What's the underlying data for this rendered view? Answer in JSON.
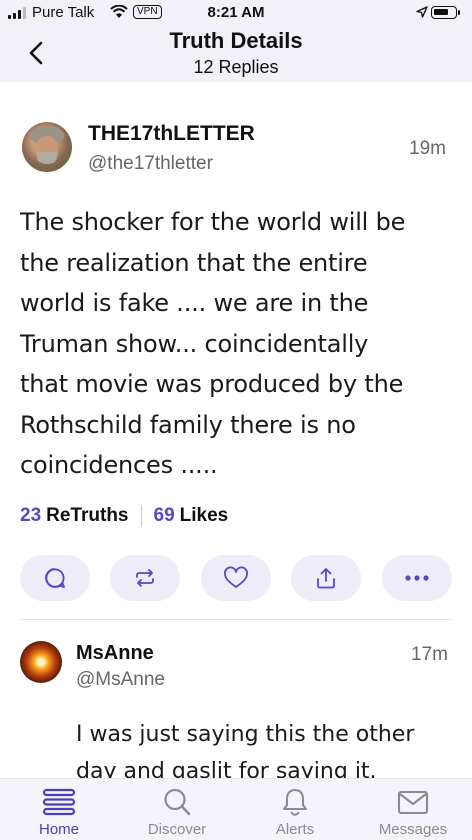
{
  "status_bar": {
    "carrier": "Pure Talk",
    "vpn": "VPN",
    "time": "8:21 AM"
  },
  "header": {
    "title": "Truth Details",
    "subtitle": "12 Replies"
  },
  "post": {
    "name": "THE17thLETTER",
    "handle": "@the17thletter",
    "time_ago": "19m",
    "lines": [
      "The shocker for the world will be",
      "the realization that the entire",
      "world is fake .... we are in the",
      "Truman show... coincidentally",
      "that movie was produced by the",
      "Rothschild family there is no",
      "coincidences ....."
    ],
    "retruths_count": "23",
    "retruths_label": "ReTruths",
    "likes_count": "69",
    "likes_label": "Likes"
  },
  "reply": {
    "name": "MsAnne",
    "handle": "@MsAnne",
    "time_ago": "17m",
    "lines": [
      "I was just saying this the other",
      "day and gaslit for saying it."
    ]
  },
  "tabs": [
    {
      "label": "Home",
      "icon": "home-icon",
      "active": true
    },
    {
      "label": "Discover",
      "icon": "search-icon",
      "active": false
    },
    {
      "label": "Alerts",
      "icon": "bell-icon",
      "active": false
    },
    {
      "label": "Messages",
      "icon": "mail-icon",
      "active": false
    }
  ],
  "colors": {
    "accent": "#5448c8",
    "header_bg": "#f3f1f8",
    "action_bg": "#efecf9"
  }
}
